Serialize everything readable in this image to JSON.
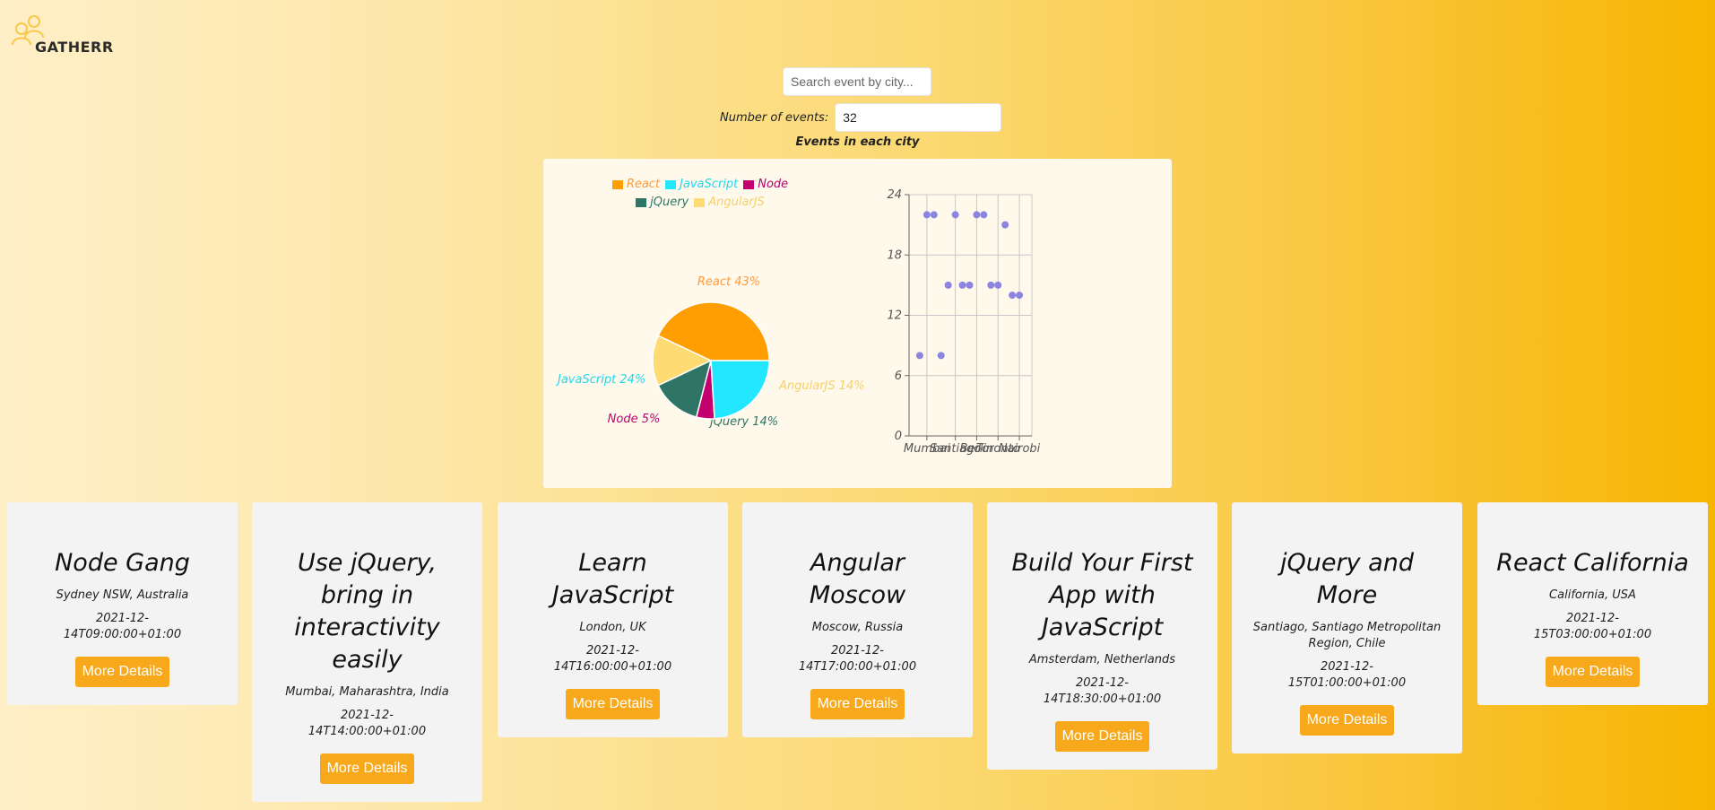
{
  "app": {
    "logo_text": "GATHERR"
  },
  "search": {
    "placeholder": "Search event by city..."
  },
  "number_of_events": {
    "label": "Number of events:",
    "value": "32"
  },
  "charts_heading": "Events in each city",
  "colors": {
    "react": "#ff9e00",
    "javascript": "#23e7ff",
    "node": "#c4006f",
    "jquery": "#2e7565",
    "angularjs": "#ffdb73",
    "scatter_point": "#8c85e0",
    "button": "#f7a81b"
  },
  "chart_data": [
    {
      "type": "pie",
      "legend": [
        "React",
        "JavaScript",
        "Node",
        "jQuery",
        "AngularJS"
      ],
      "slices": [
        {
          "name": "React",
          "value": 43,
          "label": "React 43%"
        },
        {
          "name": "AngularJS",
          "value": 14,
          "label": "AngularJS 14%"
        },
        {
          "name": "jQuery",
          "value": 14,
          "label": "jQuery 14%"
        },
        {
          "name": "Node",
          "value": 5,
          "label": "Node 5%"
        },
        {
          "name": "JavaScript",
          "value": 24,
          "label": "JavaScript 24%"
        }
      ]
    },
    {
      "type": "scatter",
      "ylim": [
        0,
        24
      ],
      "yticks": [
        0,
        6,
        12,
        18,
        24
      ],
      "xtick_labels": [
        "Mumbai",
        "Santiago",
        "Berlin",
        "Toronto",
        "Nairobi"
      ],
      "grid": true,
      "points": [
        {
          "x": 0,
          "y": 8
        },
        {
          "x": 1,
          "y": 22
        },
        {
          "x": 2,
          "y": 22
        },
        {
          "x": 3,
          "y": 8
        },
        {
          "x": 4,
          "y": 15
        },
        {
          "x": 5,
          "y": 22
        },
        {
          "x": 6,
          "y": 15
        },
        {
          "x": 7,
          "y": 15
        },
        {
          "x": 8,
          "y": 22
        },
        {
          "x": 9,
          "y": 22
        },
        {
          "x": 10,
          "y": 15
        },
        {
          "x": 11,
          "y": 15
        },
        {
          "x": 12,
          "y": 21
        },
        {
          "x": 13,
          "y": 14
        },
        {
          "x": 14,
          "y": 14
        }
      ],
      "xtick_positions": [
        1,
        5,
        8,
        11,
        14
      ]
    }
  ],
  "events": [
    {
      "title": "Node Gang",
      "location": "Sydney NSW, Australia",
      "date": "2021-12-\n14T09:00:00+01:00",
      "button": "More Details"
    },
    {
      "title": "Use jQuery, bring in interactivity easily",
      "location": "Mumbai, Maharashtra, India",
      "date": "2021-12-\n14T14:00:00+01:00",
      "button": "More Details"
    },
    {
      "title": "Learn JavaScript",
      "location": "London, UK",
      "date": "2021-12-\n14T16:00:00+01:00",
      "button": "More Details"
    },
    {
      "title": "Angular Moscow",
      "location": "Moscow, Russia",
      "date": "2021-12-\n14T17:00:00+01:00",
      "button": "More Details"
    },
    {
      "title": "Build Your First App with JavaScript",
      "location": "Amsterdam, Netherlands",
      "date": "2021-12-\n14T18:30:00+01:00",
      "button": "More Details"
    },
    {
      "title": "jQuery and More",
      "location": "Santiago, Santiago Metropolitan Region, Chile",
      "date": "2021-12-\n15T01:00:00+01:00",
      "button": "More Details"
    },
    {
      "title": "React California",
      "location": "California, USA",
      "date": "2021-12-\n15T03:00:00+01:00",
      "button": "More Details"
    }
  ]
}
